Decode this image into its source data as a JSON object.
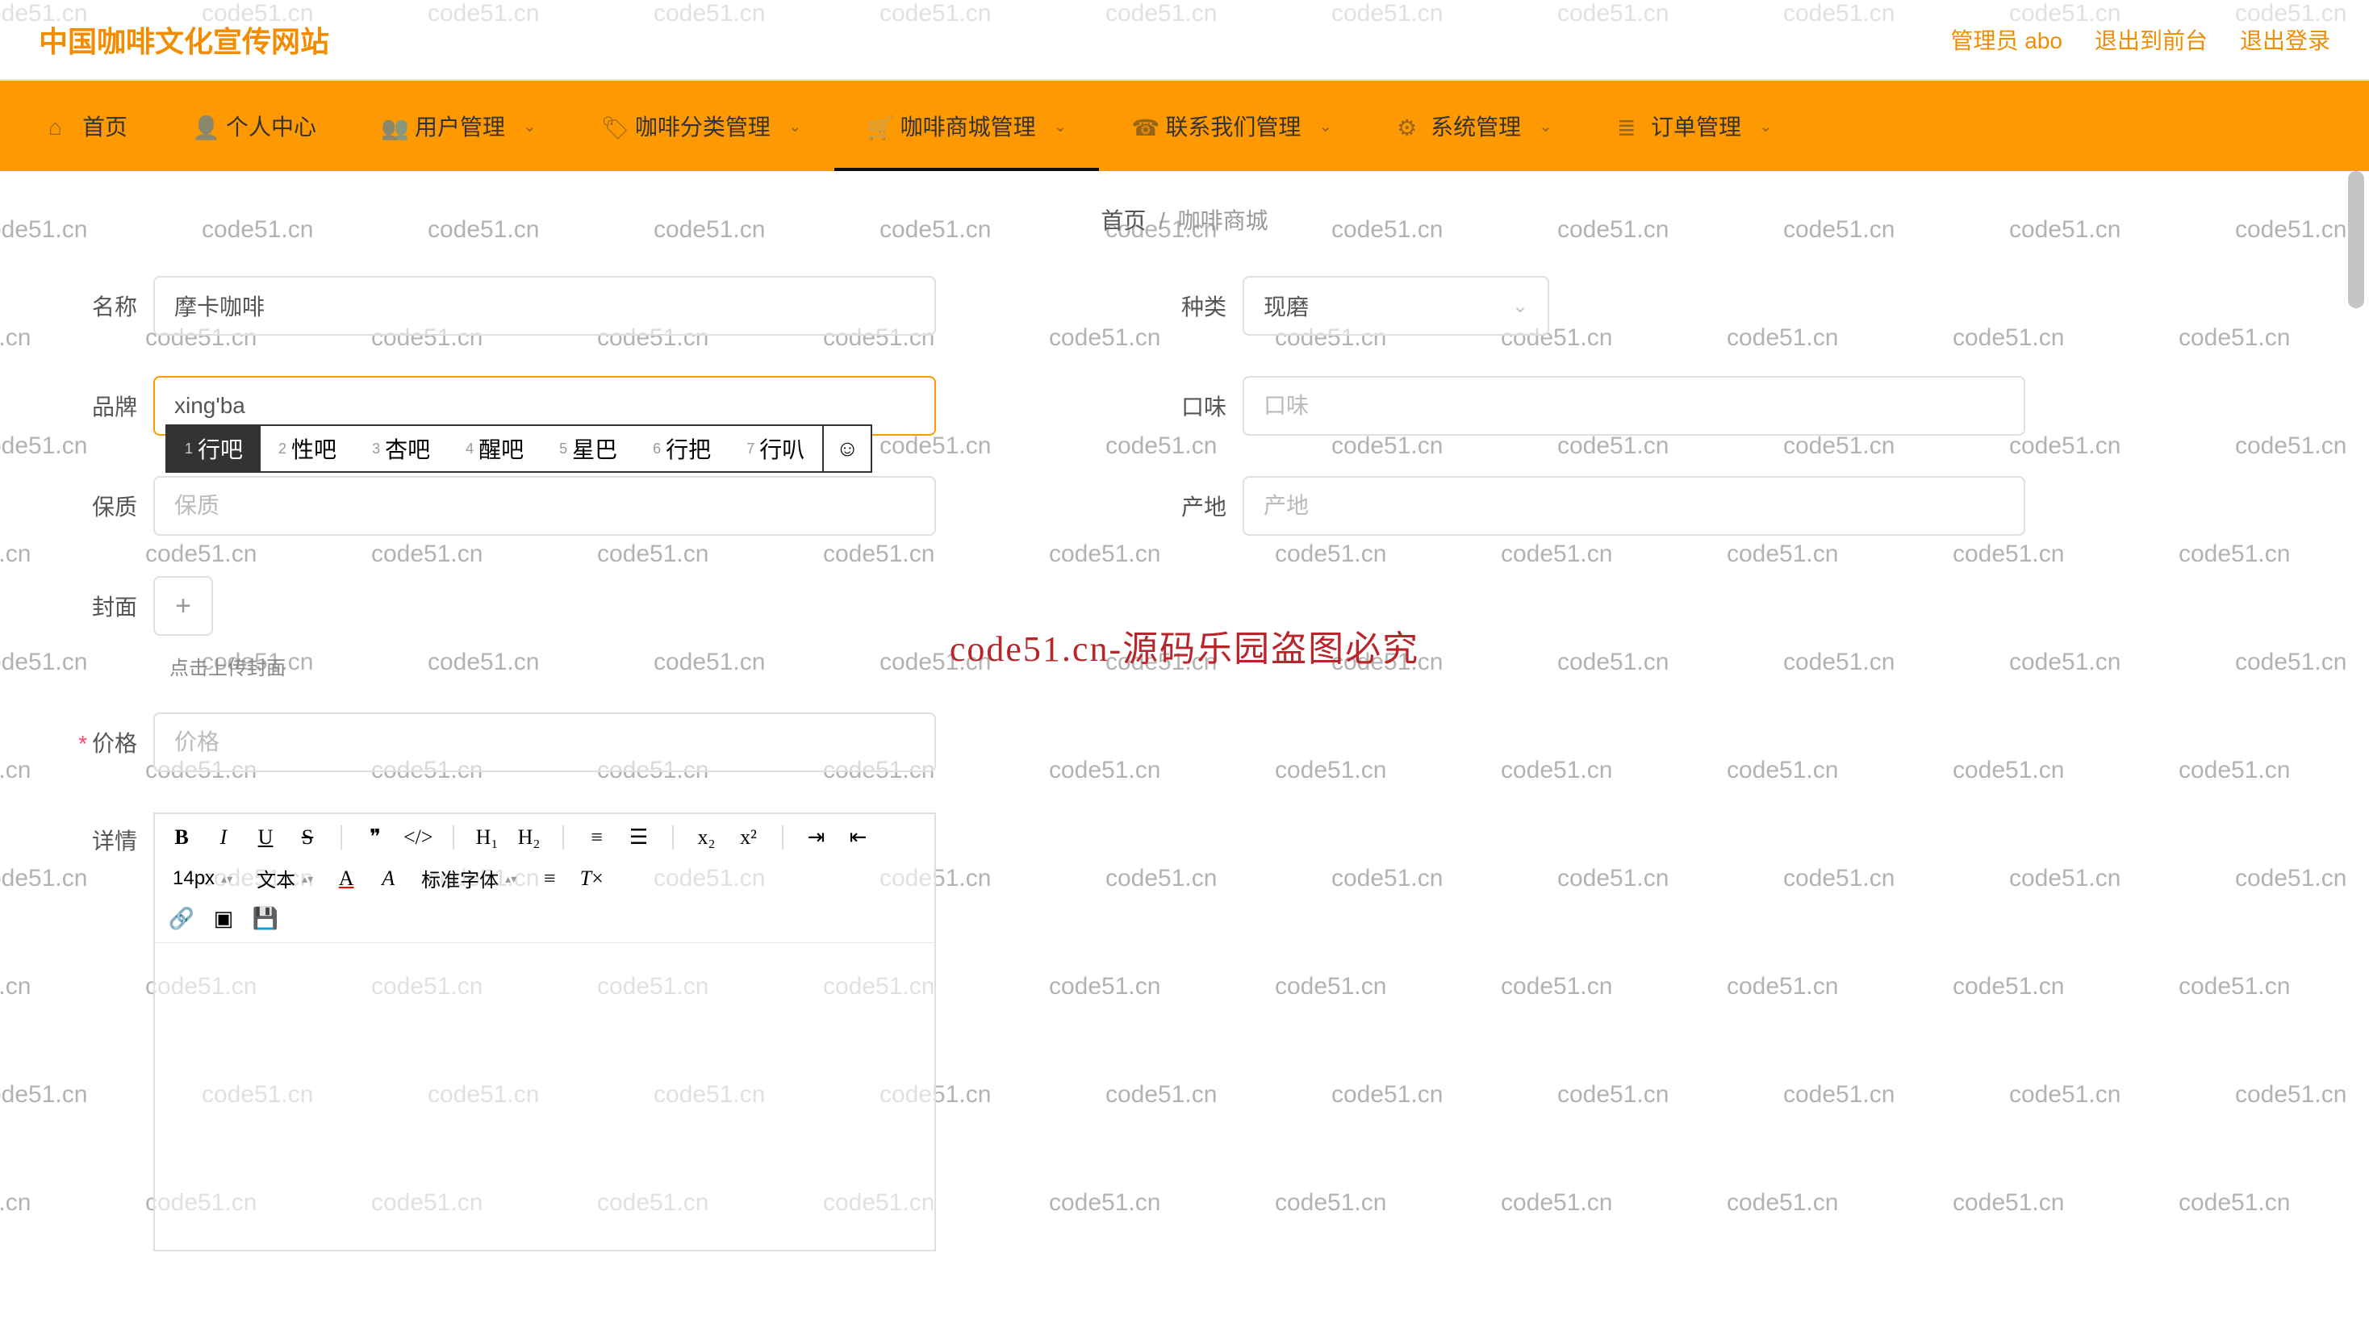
{
  "header": {
    "title": "中国咖啡文化宣传网站",
    "admin_label": "管理员 abo",
    "front_label": "退出到前台",
    "logout_label": "退出登录"
  },
  "nav": {
    "items": [
      {
        "label": "首页",
        "icon": "home"
      },
      {
        "label": "个人中心",
        "icon": "user"
      },
      {
        "label": "用户管理",
        "icon": "users",
        "caret": true
      },
      {
        "label": "咖啡分类管理",
        "icon": "tag",
        "caret": true
      },
      {
        "label": "咖啡商城管理",
        "icon": "cart",
        "caret": true,
        "active": true
      },
      {
        "label": "联系我们管理",
        "icon": "phone",
        "caret": true
      },
      {
        "label": "系统管理",
        "icon": "gear",
        "caret": true
      },
      {
        "label": "订单管理",
        "icon": "list",
        "caret": true
      }
    ]
  },
  "breadcrumb": {
    "home": "首页",
    "sep": "/",
    "current": "咖啡商城"
  },
  "form": {
    "name": {
      "label": "名称",
      "value": "摩卡咖啡"
    },
    "type": {
      "label": "种类",
      "value": "现磨"
    },
    "brand": {
      "label": "品牌",
      "value": "xing'ba"
    },
    "taste": {
      "label": "口味",
      "placeholder": "口味"
    },
    "shelf": {
      "label": "保质",
      "placeholder": "保质"
    },
    "origin": {
      "label": "产地",
      "placeholder": "产地"
    },
    "cover": {
      "label": "封面",
      "hint": "点击上传封面"
    },
    "price": {
      "label": "价格",
      "required": true,
      "placeholder": "价格"
    },
    "detail": {
      "label": "详情"
    }
  },
  "ime": {
    "candidates": [
      "行吧",
      "性吧",
      "杏吧",
      "醒吧",
      "星巴",
      "行把",
      "行叭"
    ],
    "selected": 0
  },
  "editor": {
    "font_size": "14px",
    "format": "文本",
    "font_family": "标准字体"
  },
  "watermark_text": "code51.cn",
  "center_notice": "code51.cn-源码乐园盗图必究"
}
